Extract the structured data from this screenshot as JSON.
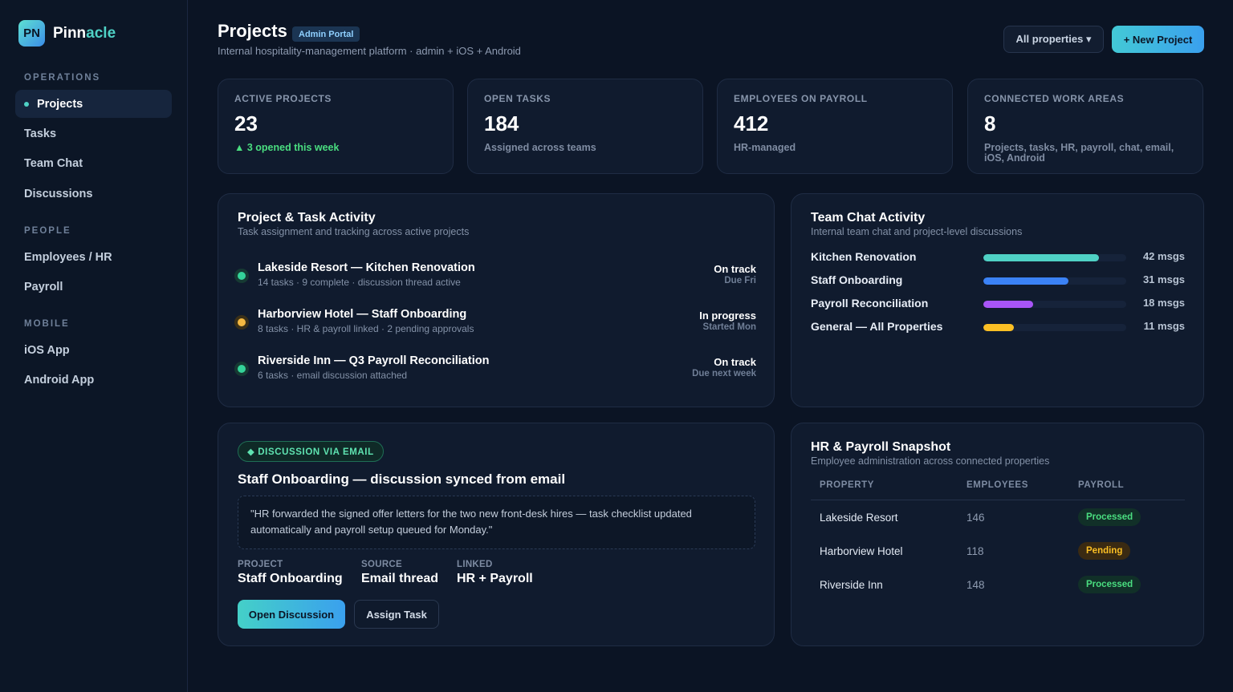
{
  "brand": {
    "logo": "PN",
    "name_main": "Pinn",
    "name_accent": "acle"
  },
  "sidebar": {
    "sections": [
      {
        "label": "OPERATIONS",
        "items": [
          {
            "label": "Projects",
            "active": true
          },
          {
            "label": "Tasks"
          },
          {
            "label": "Team Chat"
          },
          {
            "label": "Discussions"
          }
        ]
      },
      {
        "label": "PEOPLE",
        "items": [
          {
            "label": "Employees / HR"
          },
          {
            "label": "Payroll"
          }
        ]
      },
      {
        "label": "MOBILE",
        "items": [
          {
            "label": "iOS App"
          },
          {
            "label": "Android App"
          }
        ]
      }
    ]
  },
  "header": {
    "title": "Projects",
    "badge": "Admin Portal",
    "subtitle": "Internal hospitality-management platform · admin + iOS + Android",
    "filter_label": "All properties ▾",
    "new_project_label": "+ New Project"
  },
  "stats": [
    {
      "label": "Active Projects",
      "value": "23",
      "note": "▲ 3 opened this week",
      "positive": true
    },
    {
      "label": "Open Tasks",
      "value": "184",
      "note": "Assigned across teams"
    },
    {
      "label": "Employees on Payroll",
      "value": "412",
      "note": "HR-managed"
    },
    {
      "label": "Connected Work Areas",
      "value": "8",
      "note": "Projects, tasks, HR, payroll, chat, email, iOS, Android"
    }
  ],
  "activity": {
    "title": "Project & Task Activity",
    "subtitle": "Task assignment and tracking across active projects",
    "items": [
      {
        "title": "Lakeside Resort — Kitchen Renovation",
        "meta": "14 tasks · 9 complete · discussion thread active",
        "status": "On track",
        "due": "Due Fri",
        "color": "#34d399",
        "ring": "#163a33"
      },
      {
        "title": "Harborview Hotel — Staff Onboarding",
        "meta": "8 tasks · HR & payroll linked · 2 pending approvals",
        "status": "In progress",
        "due": "Started Mon",
        "color": "#f5b942",
        "ring": "#3a3018"
      },
      {
        "title": "Riverside Inn — Q3 Payroll Reconciliation",
        "meta": "6 tasks · email discussion attached",
        "status": "On track",
        "due": "Due next week",
        "color": "#34d399",
        "ring": "#163a33"
      }
    ]
  },
  "chat": {
    "title": "Team Chat Activity",
    "subtitle": "Internal team chat and project-level discussions",
    "max": 52,
    "rows": [
      {
        "name": "Kitchen Renovation",
        "count": 42,
        "count_label": "42 msgs",
        "color": "#4fd1c5"
      },
      {
        "name": "Staff Onboarding",
        "count": 31,
        "count_label": "31 msgs",
        "color": "#3b82f6"
      },
      {
        "name": "Payroll Reconciliation",
        "count": 18,
        "count_label": "18 msgs",
        "color": "#a855f7"
      },
      {
        "name": "General — All Properties",
        "count": 11,
        "count_label": "11 msgs",
        "color": "#fbbf24"
      }
    ]
  },
  "discussion": {
    "pill": "◆ DISCUSSION VIA EMAIL",
    "title": "Staff Onboarding — discussion synced from email",
    "quote": "\"HR forwarded the signed offer letters for the two new front-desk hires — task checklist updated automatically and payroll setup queued for Monday.\"",
    "project_label": "Project",
    "project_value": "Staff Onboarding",
    "source_label": "Source",
    "source_value": "Email thread",
    "linked_label": "Linked",
    "linked_value": "HR + Payroll",
    "open_label": "Open Discussion",
    "assign_label": "Assign Task"
  },
  "hr": {
    "title": "HR & Payroll Snapshot",
    "subtitle": "Employee administration across connected properties",
    "columns": [
      "PROPERTY",
      "EMPLOYEES",
      "PAYROLL"
    ],
    "rows": [
      {
        "property": "Lakeside Resort",
        "employees": "146",
        "payroll": "Processed",
        "state": "processed"
      },
      {
        "property": "Harborview Hotel",
        "employees": "118",
        "payroll": "Pending",
        "state": "pending"
      },
      {
        "property": "Riverside Inn",
        "employees": "148",
        "payroll": "Processed",
        "state": "processed"
      }
    ]
  }
}
